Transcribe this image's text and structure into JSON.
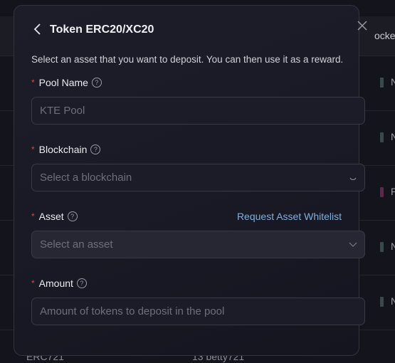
{
  "background": {
    "header_text": "ocke",
    "row_letters": [
      "N",
      "N",
      "P",
      "N",
      "N"
    ],
    "bottom_row": {
      "col1": "ERC721",
      "col2": "13 betty721"
    }
  },
  "modal": {
    "title": "Token ERC20/XC20",
    "description": "Select an asset that you want to deposit. You can then use it as a reward.",
    "fields": {
      "pool_name": {
        "label": "Pool Name",
        "value": "KTE Pool"
      },
      "blockchain": {
        "label": "Blockchain",
        "placeholder": "Select a blockchain",
        "state": "loading"
      },
      "asset": {
        "label": "Asset",
        "placeholder": "Select an asset",
        "state": "disabled",
        "link": "Request Asset Whitelist"
      },
      "amount": {
        "label": "Amount",
        "placeholder": "Amount of tokens to deposit in the pool"
      }
    },
    "required_mark": "*",
    "help_glyph": "?"
  },
  "colors": {
    "link": "#7fb0dc",
    "required": "#e0443e"
  }
}
